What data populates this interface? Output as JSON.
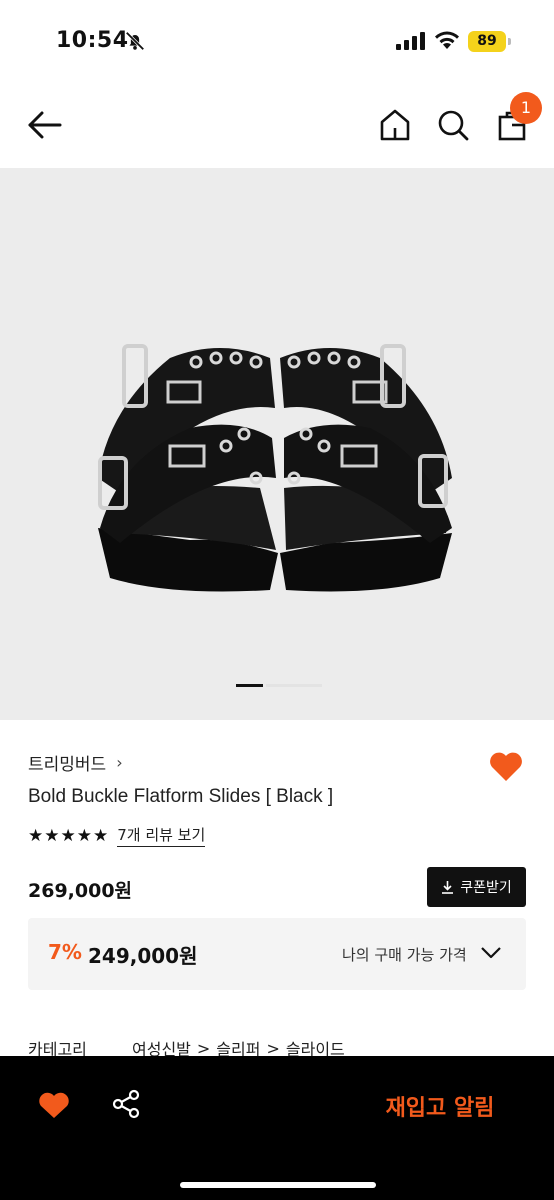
{
  "status_bar": {
    "time": "10:54",
    "battery": "89"
  },
  "nav": {
    "cart_count": "1"
  },
  "product": {
    "brand": "트리밍버드",
    "name": "Bold Buckle Flatform Slides [ Black ]",
    "stars": "★★★★★",
    "rating": 5,
    "review_link": "7개 리뷰 보기",
    "price": "269,000원",
    "coupon_label": "쿠폰받기",
    "discount_rate": "7%",
    "discount_price": "249,000원",
    "my_price_label": "나의 구매 가능 가격",
    "image_count_active": 1
  },
  "category": {
    "label": "카테고리",
    "path": [
      "여성신발",
      "슬리퍼",
      "슬라이드"
    ]
  },
  "bottom_bar": {
    "restock_label": "재입고 알림"
  },
  "colors": {
    "accent": "#f25a1c",
    "dark": "#111111",
    "image_bg": "#ececec"
  }
}
